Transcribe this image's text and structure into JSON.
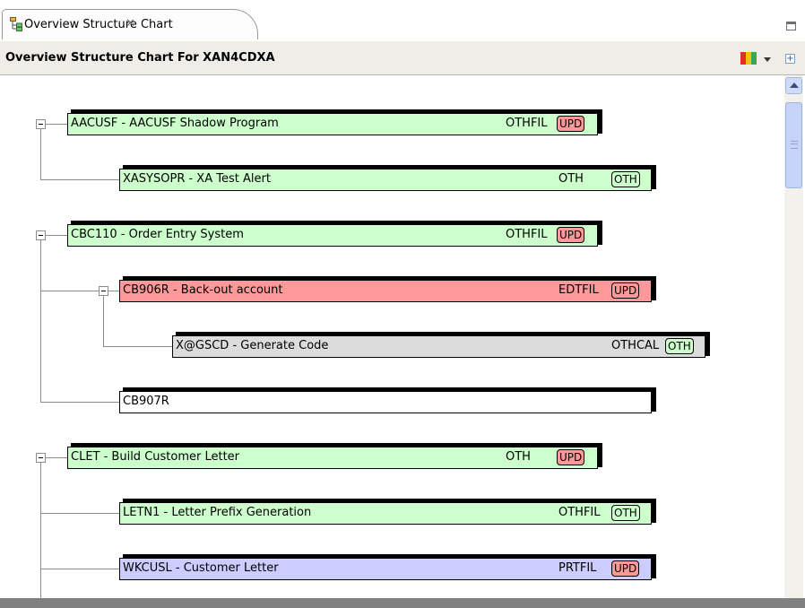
{
  "tab": {
    "label": "Overview Structure Chart",
    "close_glyph": "✕"
  },
  "header": {
    "title": "Overview Structure Chart For XAN4CDXA"
  },
  "colors": {
    "green": "#ccffcc",
    "red": "#ff9999",
    "gray": "#dcdcdc",
    "white": "#ffffff",
    "blue": "#ccccff",
    "upd_badge_bg": "#ff9999",
    "oth_badge_bg": "#ccffcc"
  },
  "nodes": [
    {
      "name": "AACUSF - AACUSF Shadow Program",
      "type": "OTHFIL",
      "badge": "UPD",
      "color": "green",
      "level": 0
    },
    {
      "name": "XASYSOPR - XA Test Alert",
      "type": "OTH",
      "badge": "OTH",
      "color": "green",
      "level": 1
    },
    {
      "name": "CBC110 - Order Entry System",
      "type": "OTHFIL",
      "badge": "UPD",
      "color": "green",
      "level": 0
    },
    {
      "name": "CB906R - Back-out account",
      "type": "EDTFIL",
      "badge": "UPD",
      "color": "red",
      "level": 1
    },
    {
      "name": "X@GSCD - Generate Code",
      "type": "OTHCAL",
      "badge": "OTH",
      "color": "gray",
      "level": 2
    },
    {
      "name": "CB907R",
      "type": "",
      "badge": "",
      "color": "white",
      "level": 1
    },
    {
      "name": "CLET - Build Customer Letter",
      "type": "OTH",
      "badge": "UPD",
      "color": "green",
      "level": 0
    },
    {
      "name": "LETN1 - Letter Prefix Generation",
      "type": "OTHFIL",
      "badge": "OTH",
      "color": "green",
      "level": 1
    },
    {
      "name": "WKCUSL - Customer Letter",
      "type": "PRTFIL",
      "badge": "UPD",
      "color": "blue",
      "level": 1
    }
  ]
}
